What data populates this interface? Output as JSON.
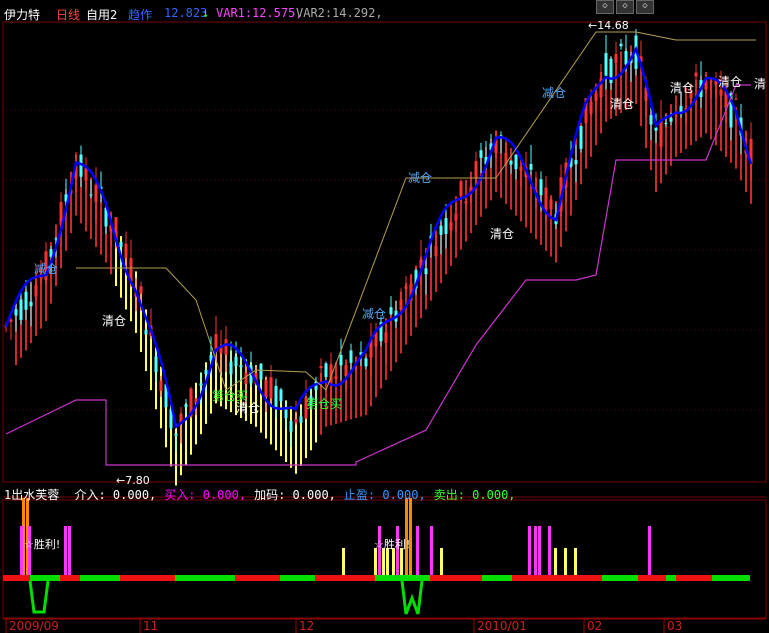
{
  "header": {
    "stock_name": "伊力特",
    "period": "日线",
    "custom": "自用2",
    "indicator_name": "趋作",
    "indicator_value": "12.823",
    "arrow": "↓",
    "var1_label": "VAR1:",
    "var1_value": "12.575,",
    "var2_label": "VAR2:",
    "var2_value": "14.292,"
  },
  "sub_header": {
    "name": "1出水芙蓉",
    "items": [
      {
        "label": "介入:",
        "value": "0.000,",
        "color": "#ffffff"
      },
      {
        "label": "买入:",
        "value": "0.000,",
        "color": "#ff00ff"
      },
      {
        "label": "加码:",
        "value": "0.000,",
        "color": "#ffffff"
      },
      {
        "label": "止盈:",
        "value": "0.000,",
        "color": "#3399ff"
      },
      {
        "label": "卖出:",
        "value": "0.000,",
        "color": "#33ff33"
      }
    ]
  },
  "colors": {
    "up": "#ff3232",
    "down": "#54ffff",
    "trend": "#0000ff",
    "support": "#cc33cc",
    "resist": "#b4a050",
    "yellow_bar": "#ffff66",
    "green_band": "#00dd00",
    "red_band": "#ee1111",
    "magenta": "#ff33ff"
  },
  "chart_data": {
    "type": "candlestick",
    "x_labels": [
      "2009/09",
      "11",
      "12",
      "2010/01",
      "02",
      "03"
    ],
    "price_labels": [
      {
        "text": "←7.80",
        "kind": "low"
      },
      {
        "text": "←14.68",
        "kind": "high"
      }
    ],
    "annotations": [
      {
        "text": "减仓",
        "color": "#55aaff"
      },
      {
        "text": "清仓",
        "color": "#ffffff"
      },
      {
        "text": "清仓",
        "color": "#ffffff"
      },
      {
        "text": "第仓买",
        "color": "#33ff33"
      },
      {
        "text": "第仓买",
        "color": "#33ff33"
      },
      {
        "text": "减仓",
        "color": "#55aaff"
      },
      {
        "text": "减仓",
        "color": "#55aaff"
      },
      {
        "text": "清仓",
        "color": "#ffffff"
      },
      {
        "text": "减仓",
        "color": "#55aaff"
      },
      {
        "text": "清仓",
        "color": "#ffffff"
      },
      {
        "text": "清仓",
        "color": "#ffffff"
      },
      {
        "text": "清仓",
        "color": "#ffffff"
      },
      {
        "text": "清",
        "color": "#ffffff"
      }
    ],
    "indicator_labels": [
      {
        "text": "☆胜利!",
        "color": "#ffffff"
      },
      {
        "text": "☆胜利!",
        "color": "#ffffff"
      }
    ],
    "ylim": [
      7.5,
      15.0
    ]
  }
}
